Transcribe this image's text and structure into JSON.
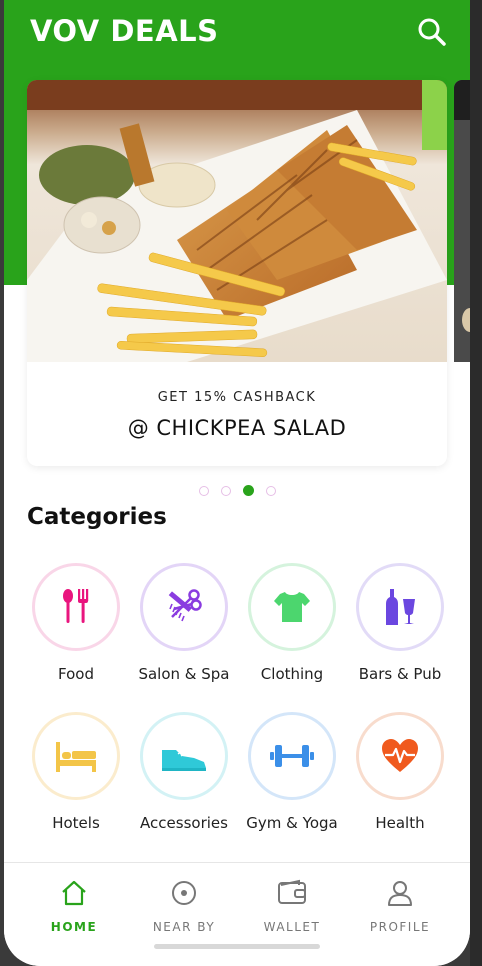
{
  "header": {
    "title": "VOV DEALS",
    "bg_color": "#29a31b"
  },
  "banner": {
    "subtitle": "GET 15% CASHBACK",
    "title": "@ CHICKPEA SALAD",
    "dots_total": 4,
    "active_dot": 3
  },
  "categories": {
    "heading": "Categories",
    "items": [
      {
        "label": "Food",
        "icon": "fork-spoon-icon",
        "color": "#e9157e"
      },
      {
        "label": "Salon & Spa",
        "icon": "scissors-comb-icon",
        "color": "#8a3ce0"
      },
      {
        "label": "Clothing",
        "icon": "tshirt-icon",
        "color": "#4cd66e"
      },
      {
        "label": "Bars & Pub",
        "icon": "bottle-glass-icon",
        "color": "#6b47e0"
      },
      {
        "label": "Hotels",
        "icon": "bed-icon",
        "color": "#f3c548"
      },
      {
        "label": "Accessories",
        "icon": "shoe-icon",
        "color": "#2fc9d8"
      },
      {
        "label": "Gym & Yoga",
        "icon": "dumbbell-icon",
        "color": "#3b8fe8"
      },
      {
        "label": "Health",
        "icon": "heart-pulse-icon",
        "color": "#f05a1e"
      }
    ]
  },
  "nav": {
    "items": [
      {
        "label": "HOME",
        "icon": "home-icon",
        "active": true
      },
      {
        "label": "NEAR BY",
        "icon": "location-icon",
        "active": false
      },
      {
        "label": "WALLET",
        "icon": "wallet-icon",
        "active": false
      },
      {
        "label": "PROFILE",
        "icon": "profile-icon",
        "active": false
      }
    ],
    "active_color": "#29a31b"
  }
}
